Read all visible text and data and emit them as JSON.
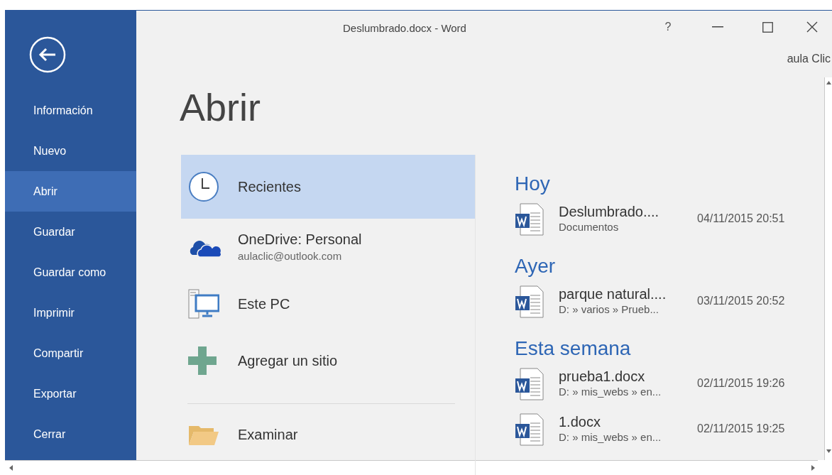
{
  "window": {
    "title": "Deslumbrado.docx - Word",
    "help": "?",
    "account": "aula Clic"
  },
  "nav": {
    "items": [
      {
        "label": "Información",
        "selected": false
      },
      {
        "label": "Nuevo",
        "selected": false
      },
      {
        "label": "Abrir",
        "selected": true
      },
      {
        "label": "Guardar",
        "selected": false
      },
      {
        "label": "Guardar como",
        "selected": false
      },
      {
        "label": "Imprimir",
        "selected": false
      },
      {
        "label": "Compartir",
        "selected": false
      },
      {
        "label": "Exportar",
        "selected": false
      },
      {
        "label": "Cerrar",
        "selected": false
      }
    ]
  },
  "page_title": "Abrir",
  "places": [
    {
      "kind": "recent",
      "label": "Recientes",
      "selected": true
    },
    {
      "kind": "onedrive",
      "label": "OneDrive: Personal",
      "sublabel": "aulaclic@outlook.com",
      "selected": false
    },
    {
      "kind": "pc",
      "label": "Este PC",
      "selected": false
    },
    {
      "kind": "add",
      "label": "Agregar un sitio",
      "selected": false
    }
  ],
  "browse": {
    "label": "Examinar"
  },
  "recent_groups": [
    {
      "heading": "Hoy",
      "files": [
        {
          "name": "Deslumbrado....",
          "location": "Documentos",
          "modified": "04/11/2015 20:51"
        }
      ]
    },
    {
      "heading": "Ayer",
      "files": [
        {
          "name": "parque natural....",
          "location": "D: » varios » Prueb...",
          "modified": "03/11/2015 20:52"
        }
      ]
    },
    {
      "heading": "Esta semana",
      "files": [
        {
          "name": "prueba1.docx",
          "location": "D: » mis_webs » en...",
          "modified": "02/11/2015 19:26"
        },
        {
          "name": "1.docx",
          "location": "D: » mis_webs » en...",
          "modified": "02/11/2015 19:25"
        }
      ]
    }
  ]
}
